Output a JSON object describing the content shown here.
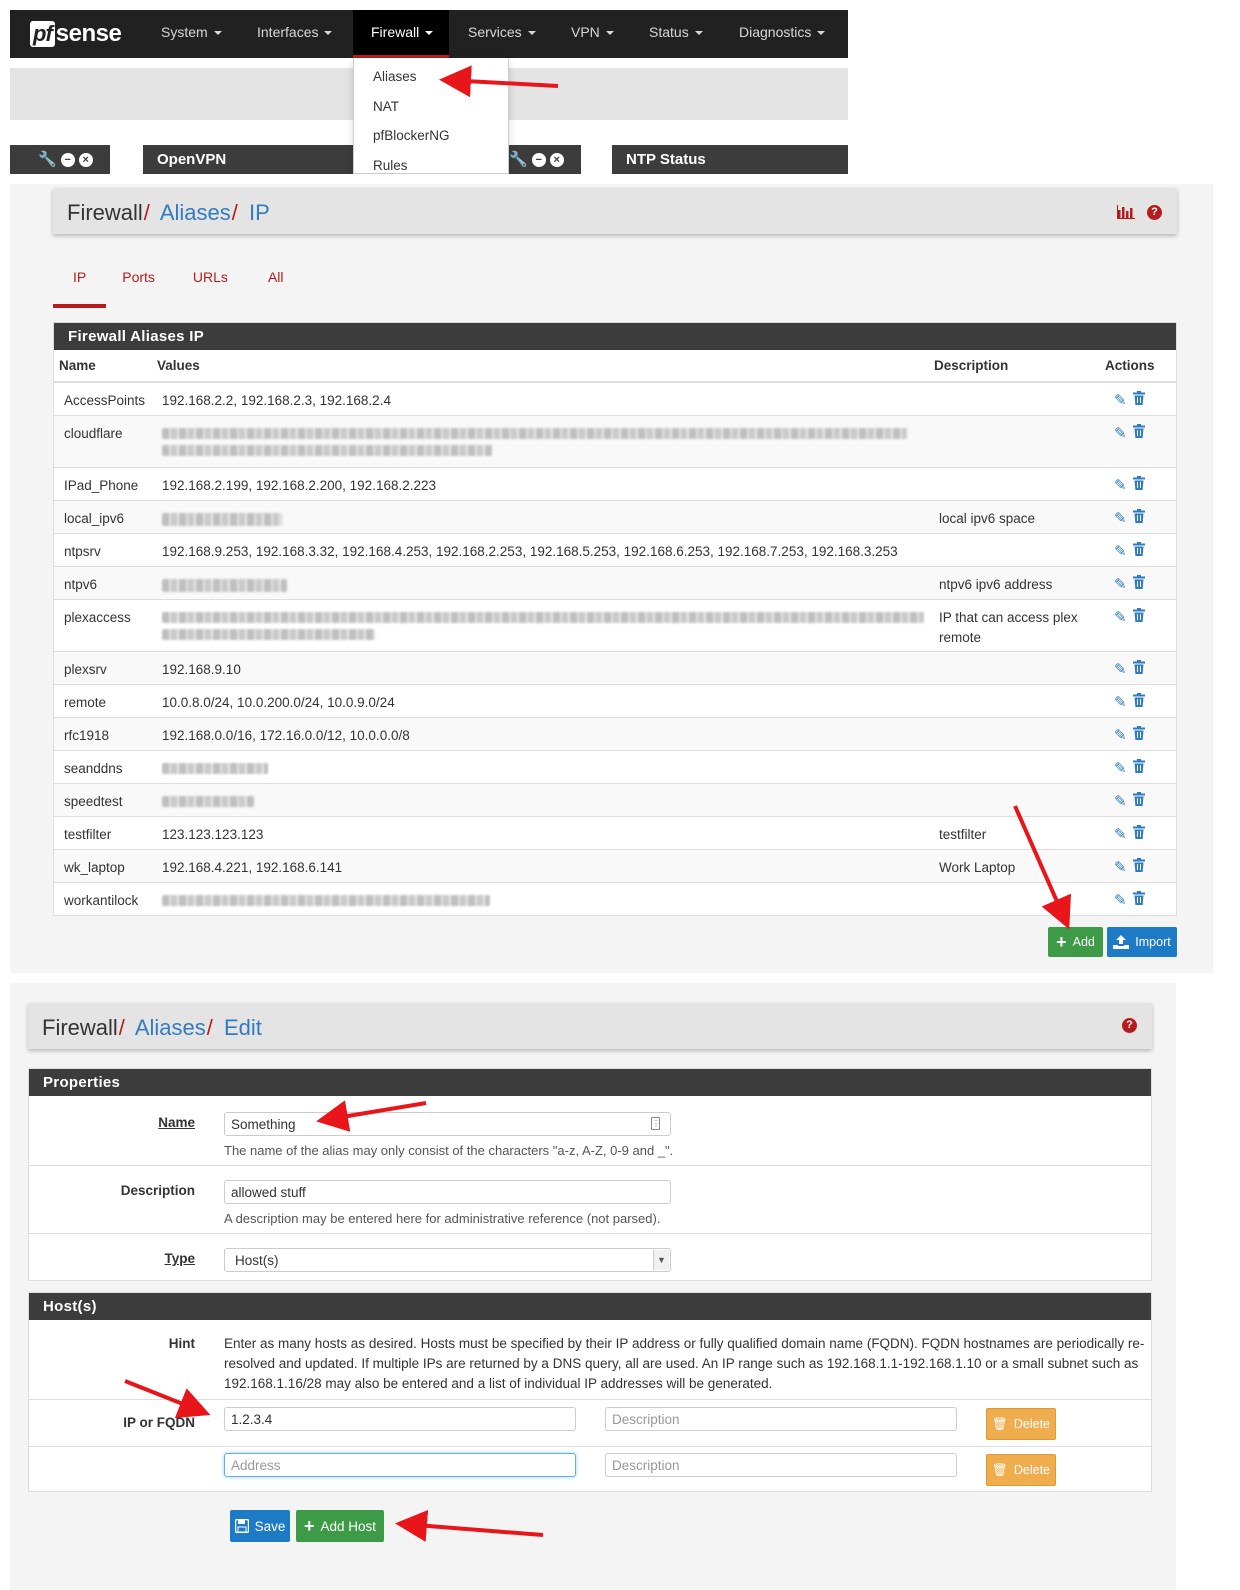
{
  "navbar": {
    "logo_pf": "pf",
    "logo_sense": "sense",
    "items": [
      "System",
      "Interfaces",
      "Firewall",
      "Services",
      "VPN",
      "Status",
      "Diagnostics"
    ],
    "dropdown": [
      "Aliases",
      "NAT",
      "pfBlockerNG",
      "Rules"
    ],
    "panels": {
      "openvpn": "OpenVPN",
      "ntp": "NTP Status"
    }
  },
  "list_page": {
    "breadcrumb": {
      "root": "Firewall",
      "sep": "/",
      "aliases": "Aliases",
      "current": "IP"
    },
    "tabs": [
      "IP",
      "Ports",
      "URLs",
      "All"
    ],
    "panel_title": "Firewall Aliases IP",
    "columns": {
      "name": "Name",
      "values": "Values",
      "description": "Description",
      "actions": "Actions"
    },
    "rows": [
      {
        "name": "AccessPoints",
        "values": "192.168.2.2, 192.168.2.3, 192.168.2.4",
        "description": ""
      },
      {
        "name": "cloudflare",
        "values": "",
        "description": ""
      },
      {
        "name": "IPad_Phone",
        "values": "192.168.2.199, 192.168.2.200, 192.168.2.223",
        "description": ""
      },
      {
        "name": "local_ipv6",
        "values": "",
        "description": "local ipv6 space"
      },
      {
        "name": "ntpsrv",
        "values": "192.168.9.253, 192.168.3.32, 192.168.4.253, 192.168.2.253, 192.168.5.253, 192.168.6.253, 192.168.7.253, 192.168.3.253",
        "description": ""
      },
      {
        "name": "ntpv6",
        "values": "",
        "description": "ntpv6 ipv6 address"
      },
      {
        "name": "plexaccess",
        "values": "",
        "description": "IP that can access plex remote"
      },
      {
        "name": "plexsrv",
        "values": "192.168.9.10",
        "description": ""
      },
      {
        "name": "remote",
        "values": "10.0.8.0/24, 10.0.200.0/24, 10.0.9.0/24",
        "description": ""
      },
      {
        "name": "rfc1918",
        "values": "192.168.0.0/16, 172.16.0.0/12, 10.0.0.0/8",
        "description": ""
      },
      {
        "name": "seanddns",
        "values": "",
        "description": ""
      },
      {
        "name": "speedtest",
        "values": "",
        "description": ""
      },
      {
        "name": "testfilter",
        "values": "123.123.123.123",
        "description": "testfilter"
      },
      {
        "name": "wk_laptop",
        "values": "192.168.4.221, 192.168.6.141",
        "description": "Work Laptop"
      },
      {
        "name": "workantilock",
        "values": "",
        "description": ""
      }
    ],
    "add_label": "Add",
    "import_label": "Import"
  },
  "edit_page": {
    "breadcrumb": {
      "root": "Firewall",
      "sep": "/",
      "aliases": "Aliases",
      "current": "Edit"
    },
    "properties_title": "Properties",
    "name_label": "Name",
    "name_value": "Something",
    "name_help": "The name of the alias may only consist of the characters \"a-z, A-Z, 0-9 and _\".",
    "desc_label": "Description",
    "desc_value": "allowed stuff",
    "desc_help": "A description may be entered here for administrative reference (not parsed).",
    "type_label": "Type",
    "type_value": "Host(s)",
    "hosts_title": "Host(s)",
    "hint_label": "Hint",
    "hint_text": "Enter as many hosts as desired. Hosts must be specified by their IP address or fully qualified domain name (FQDN). FQDN hostnames are periodically re-resolved and updated. If multiple IPs are returned by a DNS query, all are used. An IP range such as 192.168.1.1-192.168.1.10 or a small subnet such as 192.168.1.16/28 may also be entered and a list of individual IP addresses will be generated.",
    "ip_label": "IP or FQDN",
    "host1_value": "1.2.3.4",
    "address_placeholder": "Address",
    "description_placeholder": "Description",
    "delete_label": "Delete",
    "save_label": "Save",
    "add_host_label": "Add Host"
  },
  "colors": {
    "accent_red": "#b71c1c",
    "link_blue": "#317cc1",
    "add_green": "#3d9b47",
    "import_blue": "#1d7bc6",
    "delete_orange": "#f0ad4e",
    "nav_dark": "#212121"
  }
}
